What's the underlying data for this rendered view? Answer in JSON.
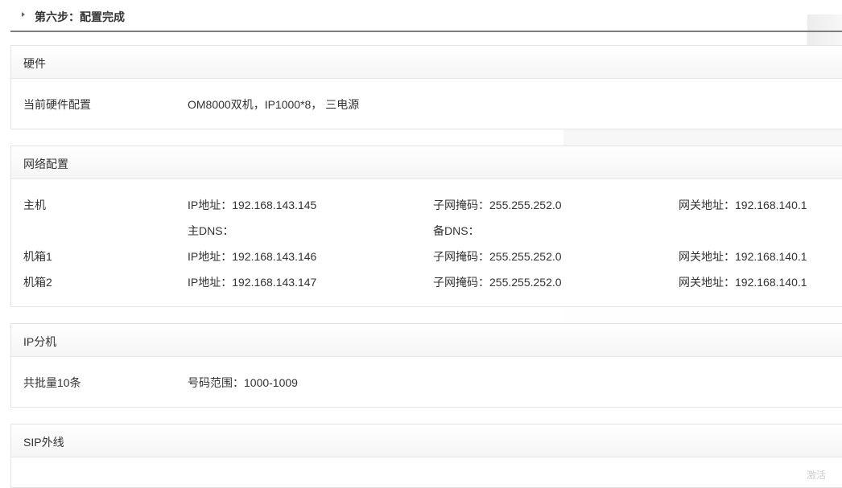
{
  "step": {
    "title": "第六步：配置完成"
  },
  "hardware": {
    "title": "硬件",
    "label": "当前硬件配置",
    "value": "OM8000双机，IP1000*8， 三电源"
  },
  "network": {
    "title": "网络配置",
    "rows": [
      {
        "name": "主机",
        "ip": "IP地址：192.168.143.145",
        "mask": "子网掩码：255.255.252.0",
        "gateway": "网关地址：192.168.140.1"
      },
      {
        "name": "",
        "ip": "主DNS：",
        "mask": "备DNS：",
        "gateway": ""
      },
      {
        "name": "机箱1",
        "ip": "IP地址：192.168.143.146",
        "mask": "子网掩码：255.255.252.0",
        "gateway": "网关地址：192.168.140.1"
      },
      {
        "name": "机箱2",
        "ip": "IP地址：192.168.143.147",
        "mask": "子网掩码：255.255.252.0",
        "gateway": "网关地址：192.168.140.1"
      }
    ]
  },
  "ip_ext": {
    "title": "IP分机",
    "count": "共批量10条",
    "range": "号码范围：1000-1009"
  },
  "sip": {
    "title": "SIP外线"
  },
  "watermark": "激活"
}
